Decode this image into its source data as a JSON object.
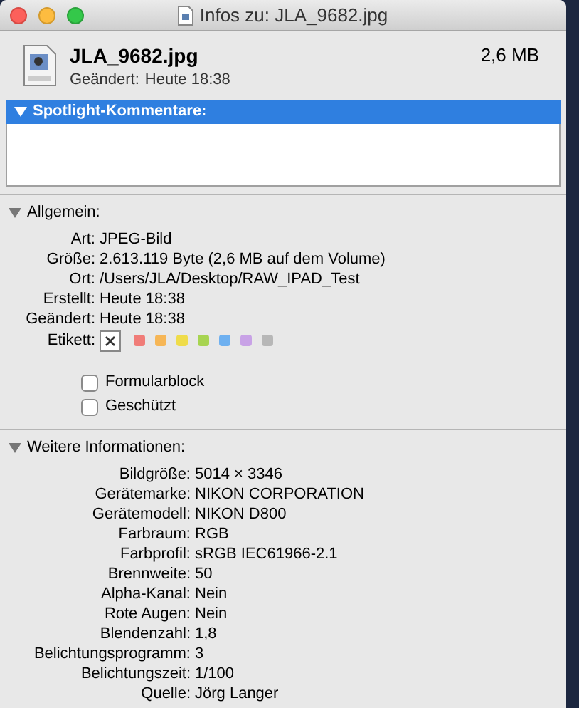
{
  "window": {
    "title": "Infos zu: JLA_9682.jpg"
  },
  "header": {
    "filename": "JLA_9682.jpg",
    "size": "2,6 MB",
    "modified_label": "Geändert:",
    "modified": "Heute 18:38"
  },
  "sections": [
    {
      "title": "Spotlight-Kommentare:",
      "expanded": true,
      "selected": true,
      "kind": "comments"
    },
    {
      "title": "Allgemein:",
      "expanded": true,
      "selected": false,
      "kind": "general",
      "rows": [
        {
          "label": "Art:",
          "value": "JPEG-Bild"
        },
        {
          "label": "Größe:",
          "value": "2.613.119 Byte (2,6 MB auf dem Volume)"
        },
        {
          "label": "Ort:",
          "value": "/Users/JLA/Desktop/RAW_IPAD_Test"
        },
        {
          "label": "Erstellt:",
          "value": "Heute 18:38"
        },
        {
          "label": "Geändert:",
          "value": "Heute 18:38"
        }
      ],
      "tag_label": "Etikett:",
      "tags": [
        {
          "kind": "none",
          "selected": true
        },
        {
          "kind": "color",
          "color": "#f07c78",
          "selected": false
        },
        {
          "kind": "color",
          "color": "#f6b656",
          "selected": false
        },
        {
          "kind": "color",
          "color": "#efdc4a",
          "selected": false
        },
        {
          "kind": "color",
          "color": "#a7d451",
          "selected": false
        },
        {
          "kind": "color",
          "color": "#6eb0f0",
          "selected": false
        },
        {
          "kind": "color",
          "color": "#c8a2e6",
          "selected": false
        },
        {
          "kind": "color",
          "color": "#b7b7b7",
          "selected": false
        }
      ],
      "checkboxes": [
        {
          "label": "Formularblock",
          "checked": false
        },
        {
          "label": "Geschützt",
          "checked": false
        }
      ]
    },
    {
      "title": "Weitere Informationen:",
      "expanded": true,
      "selected": false,
      "kind": "more",
      "rows": [
        {
          "label": "Bildgröße:",
          "value": "5014 × 3346"
        },
        {
          "label": "Gerätemarke:",
          "value": "NIKON CORPORATION"
        },
        {
          "label": "Gerätemodell:",
          "value": "NIKON D800"
        },
        {
          "label": "Farbraum:",
          "value": "RGB"
        },
        {
          "label": "Farbprofil:",
          "value": "sRGB IEC61966-2.1"
        },
        {
          "label": "Brennweite:",
          "value": "50"
        },
        {
          "label": "Alpha-Kanal:",
          "value": "Nein"
        },
        {
          "label": "Rote Augen:",
          "value": "Nein"
        },
        {
          "label": "Blendenzahl:",
          "value": "1,8"
        },
        {
          "label": "Belichtungsprogramm:",
          "value": "3"
        },
        {
          "label": "Belichtungszeit:",
          "value": "1/100"
        },
        {
          "label": "Quelle:",
          "value": "Jörg Langer"
        }
      ]
    }
  ]
}
